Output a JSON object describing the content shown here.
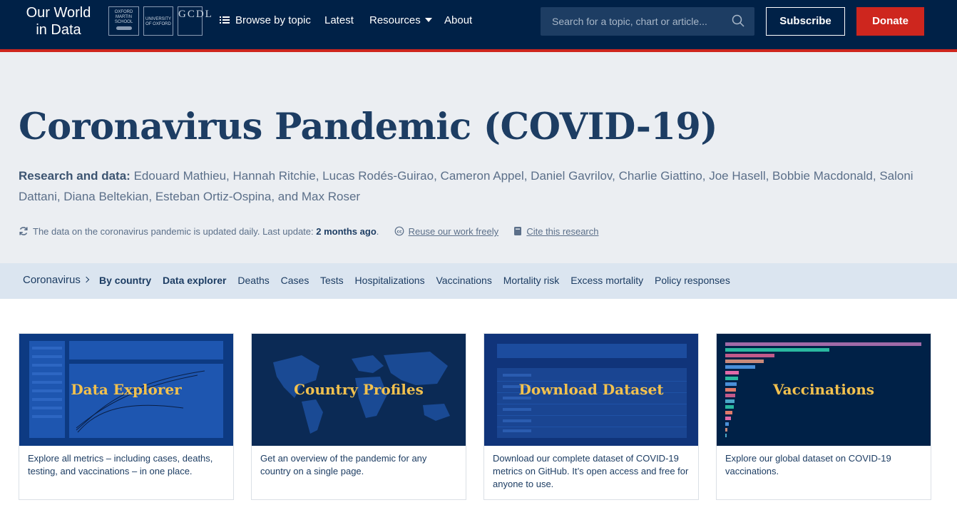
{
  "nav": {
    "logo_line1": "Our World",
    "logo_line2": "in Data",
    "partner1": "OXFORD MARTIN SCHOOL",
    "partner2": "UNIVERSITY OF OXFORD",
    "partner3": "GCDL",
    "browse": "Browse by topic",
    "latest": "Latest",
    "resources": "Resources",
    "about": "About",
    "search_placeholder": "Search for a topic, chart or article...",
    "subscribe": "Subscribe",
    "donate": "Donate"
  },
  "header": {
    "title": "Coronavirus Pandemic (COVID-19)",
    "authors_label": "Research and data:",
    "authors": "Edouard Mathieu, Hannah Ritchie, Lucas Rodés-Guirao, Cameron Appel, Daniel Gavrilov, Charlie Giattino, Joe Hasell, Bobbie Macdonald, Saloni Dattani, Diana Beltekian, Esteban Ortiz-Ospina, and Max Roser",
    "update_text": "The data on the coronavirus pandemic is updated daily. Last update:",
    "update_when": "2 months ago",
    "update_dot": ".",
    "reuse": "Reuse our work freely",
    "cite": "Cite this research"
  },
  "subnav": {
    "crumb": "Coronavirus",
    "links": [
      "By country",
      "Data explorer",
      "Deaths",
      "Cases",
      "Tests",
      "Hospitalizations",
      "Vaccinations",
      "Mortality risk",
      "Excess mortality",
      "Policy responses"
    ]
  },
  "cards": [
    {
      "title": "Data Explorer",
      "desc": "Explore all metrics – including cases, deaths, testing, and vaccinations – in one place."
    },
    {
      "title": "Country Profiles",
      "desc": "Get an overview of the pandemic for any country on a single page."
    },
    {
      "title": "Download Dataset",
      "desc": "Download our complete dataset of COVID-19 metrics on GitHub. It’s open access and free for anyone to use."
    },
    {
      "title": "Vaccinations",
      "desc": "Explore our global dataset on COVID-19 vaccinations."
    }
  ],
  "colors": {
    "nav_bg": "#002147",
    "accent_red": "#ce261e",
    "title_blue": "#1d3d63",
    "card_gold": "#f2c14e"
  }
}
